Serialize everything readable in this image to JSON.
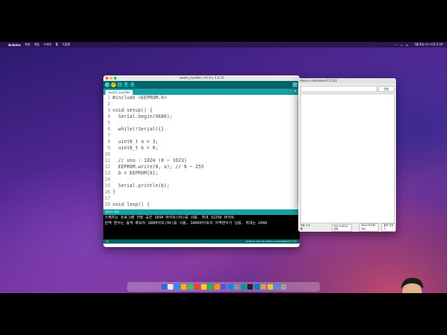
{
  "menubar": {
    "app_name": "Arduino",
    "items": [
      "파일",
      "편집",
      "스케치",
      "툴",
      "도움말"
    ],
    "clock": "3월 8일 (수) 오후 6:10"
  },
  "ide": {
    "window_title": "sketch_mar08d | 아두이노 1.8.19",
    "tab_name": "sketch_mar08d",
    "code_lines": [
      {
        "n": "1",
        "text": "#include <EEPROM.h>"
      },
      {
        "n": "2",
        "text": ""
      },
      {
        "n": "3",
        "text": "void setup() {"
      },
      {
        "n": "4",
        "text": "  Serial.begin(9600);"
      },
      {
        "n": "5",
        "text": ""
      },
      {
        "n": "6",
        "text": "  while(!Serial){}"
      },
      {
        "n": "7",
        "text": ""
      },
      {
        "n": "8",
        "text": "  uint8_t a = 3;"
      },
      {
        "n": "9",
        "text": "  uint8_t b = 0;"
      },
      {
        "n": "10",
        "text": ""
      },
      {
        "n": "11",
        "text": "  // uno : 1024 (0 ~ 1023)"
      },
      {
        "n": "12",
        "text": "  EEPROM.write(0, a); // 0 ~ 255"
      },
      {
        "n": "13",
        "text": "  b = EEPROM[0];"
      },
      {
        "n": "14",
        "text": ""
      },
      {
        "n": "15",
        "text": "  Serial.println(b);"
      },
      {
        "n": "16",
        "text": "}"
      },
      {
        "n": "17",
        "text": ""
      },
      {
        "n": "18",
        "text": "void loop() {"
      }
    ],
    "status": "업로드 완료.",
    "console_lines": [
      "스케치는 프로그램 저장 공간 1694 바이트(5%)를 사용. 최대 32256 바이트.",
      "전역 변수는 동적 메모리 188바이트(9%)를 사용, 1860바이트의 지역변수가 남음.  최대는 2048"
    ],
    "footer_line": "15",
    "footer_board": "Arduino Uno on /dev/cu.usbmodem11101"
  },
  "serial_monitor": {
    "title": "/dev/cu.usbmodem111201",
    "send_label": "전송",
    "autoscroll": "자동 스크롤",
    "line_ending": "line ending 없음",
    "baud": "9600 보드레이트",
    "clear_label": "출력 지우기"
  }
}
